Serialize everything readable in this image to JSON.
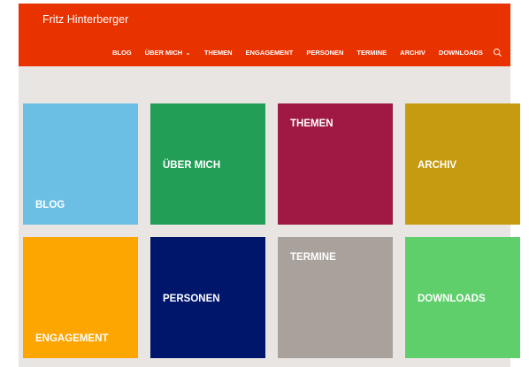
{
  "header": {
    "site_title": "Fritz Hinterberger",
    "bg_color": "#e83200",
    "nav": [
      {
        "label": "BLOG"
      },
      {
        "label": "ÜBER MICH",
        "has_dropdown": true
      },
      {
        "label": "THEMEN"
      },
      {
        "label": "ENGAGEMENT"
      },
      {
        "label": "PERSONEN"
      },
      {
        "label": "TERMINE"
      },
      {
        "label": "ARCHIV"
      },
      {
        "label": "DOWNLOADS"
      }
    ],
    "search_icon": "search-icon",
    "dropdown_icon": "chevron-down-icon"
  },
  "tiles": [
    {
      "label": "BLOG",
      "color": "#6bbfe5",
      "label_position": "bottom"
    },
    {
      "label": "ÜBER MICH",
      "color": "#229e56",
      "label_position": "middle"
    },
    {
      "label": "THEMEN",
      "color": "#a01944",
      "label_position": "top"
    },
    {
      "label": "ARCHIV",
      "color": "#c79b10",
      "label_position": "middle"
    },
    {
      "label": "ENGAGEMENT",
      "color": "#fda501",
      "label_position": "bottom"
    },
    {
      "label": "PERSONEN",
      "color": "#00166b",
      "label_position": "middle"
    },
    {
      "label": "TERMINE",
      "color": "#a9a29c",
      "label_position": "top"
    },
    {
      "label": "DOWNLOADS",
      "color": "#5fcf6c",
      "label_position": "middle"
    }
  ]
}
